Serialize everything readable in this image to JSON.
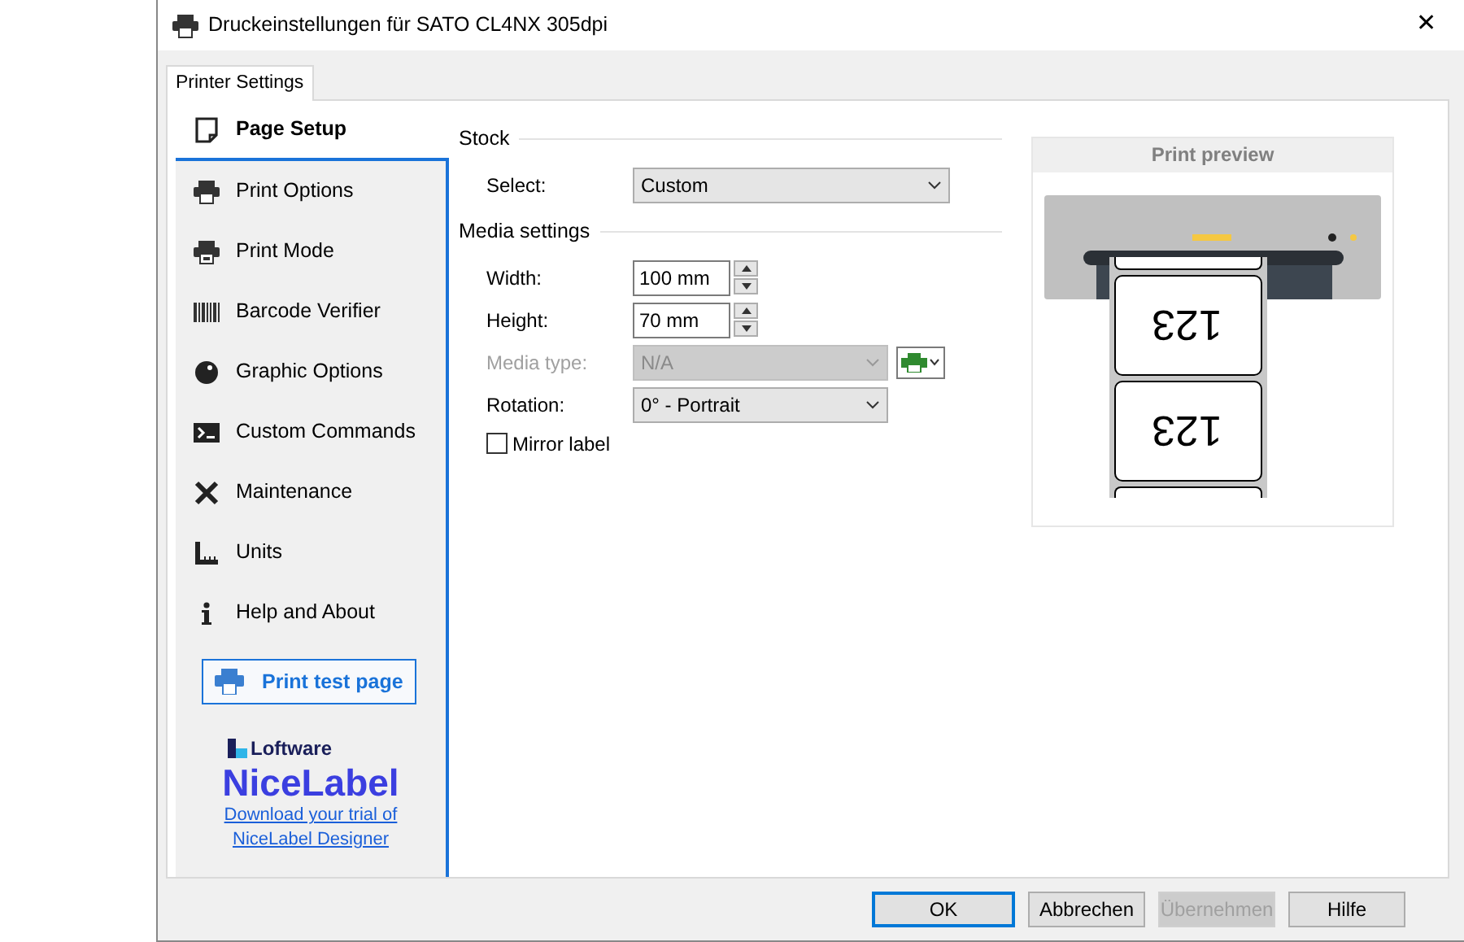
{
  "window": {
    "title": "Druckeinstellungen für SATO CL4NX 305dpi",
    "close": "✕"
  },
  "tabs": [
    {
      "label": "Printer Settings",
      "selected": true
    }
  ],
  "sidebar": {
    "items": [
      {
        "label": "Page Setup",
        "selected": true
      },
      {
        "label": "Print Options",
        "selected": false
      },
      {
        "label": "Print Mode",
        "selected": false
      },
      {
        "label": "Barcode Verifier",
        "selected": false
      },
      {
        "label": "Graphic Options",
        "selected": false
      },
      {
        "label": "Custom Commands",
        "selected": false
      },
      {
        "label": "Maintenance",
        "selected": false
      },
      {
        "label": "Units",
        "selected": false
      },
      {
        "label": "Help and About",
        "selected": false
      }
    ],
    "test_button": "Print test page",
    "brand": {
      "company": "Loftware",
      "product": "NiceLabel",
      "link": "Download your trial of NiceLabel Designer"
    }
  },
  "stock": {
    "heading": "Stock",
    "fields": [
      {
        "kind": "select",
        "label": "Select:",
        "value": "Custom",
        "disabled": false
      }
    ]
  },
  "media": {
    "heading": "Media settings",
    "fields": [
      {
        "kind": "spin",
        "label": "Width:",
        "value": "100 mm",
        "disabled": false
      },
      {
        "kind": "spin",
        "label": "Height:",
        "value": "70 mm",
        "disabled": false
      },
      {
        "kind": "select",
        "label": "Media type:",
        "value": "N/A",
        "disabled": true,
        "menu_button": true
      },
      {
        "kind": "select",
        "label": "Rotation:",
        "value": "0° - Portrait",
        "disabled": false
      }
    ],
    "checkbox": {
      "label": "Mirror label",
      "checked": false
    }
  },
  "preview": {
    "title": "Print preview",
    "labels": [
      "123",
      "123"
    ]
  },
  "buttons": [
    {
      "label": "OK",
      "default": true,
      "disabled": false
    },
    {
      "label": "Abbrechen",
      "default": false,
      "disabled": false
    },
    {
      "label": "Übernehmen",
      "default": false,
      "disabled": true
    },
    {
      "label": "Hilfe",
      "default": false,
      "disabled": false
    }
  ]
}
